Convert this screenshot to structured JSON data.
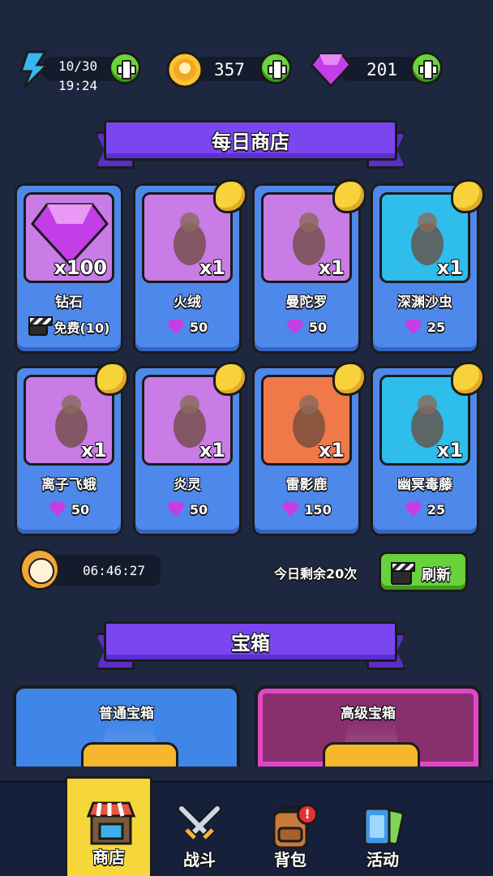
{
  "topbar": {
    "energy": {
      "value": "10/30",
      "timer": "19:24"
    },
    "coins": {
      "value": "357"
    },
    "gems": {
      "value": "201"
    }
  },
  "daily_shop": {
    "title": "每日商店",
    "items": [
      {
        "name": "钻石",
        "qty": "x100",
        "price": "免费(10)",
        "price_type": "video",
        "bg": "#c97be6"
      },
      {
        "name": "火绒",
        "qty": "x1",
        "price": "50",
        "price_type": "gem",
        "bg": "#c97be6"
      },
      {
        "name": "曼陀罗",
        "qty": "x1",
        "price": "50",
        "price_type": "gem",
        "bg": "#c97be6"
      },
      {
        "name": "深渊沙虫",
        "qty": "x1",
        "price": "25",
        "price_type": "gem",
        "bg": "#2fbdec"
      },
      {
        "name": "离子飞蛾",
        "qty": "x1",
        "price": "50",
        "price_type": "gem",
        "bg": "#c97be6"
      },
      {
        "name": "炎灵",
        "qty": "x1",
        "price": "50",
        "price_type": "gem",
        "bg": "#c97be6"
      },
      {
        "name": "雷影鹿",
        "qty": "x1",
        "price": "150",
        "price_type": "gem",
        "bg": "#f0794a"
      },
      {
        "name": "幽冥毒藤",
        "qty": "x1",
        "price": "25",
        "price_type": "gem",
        "bg": "#2fbdec"
      }
    ],
    "countdown": "06:46:27",
    "refresh_remaining": "今日剩余20次",
    "refresh_label": "刷新"
  },
  "chests": {
    "title": "宝箱",
    "normal": {
      "label": "普通宝箱",
      "color": "#3f86e8"
    },
    "premium": {
      "label": "高级宝箱",
      "color": "#8a2f6e"
    }
  },
  "nav": [
    {
      "label": "商店",
      "active": true
    },
    {
      "label": "战斗",
      "active": false
    },
    {
      "label": "背包",
      "active": false,
      "badge": "!"
    },
    {
      "label": "活动",
      "active": false
    }
  ]
}
